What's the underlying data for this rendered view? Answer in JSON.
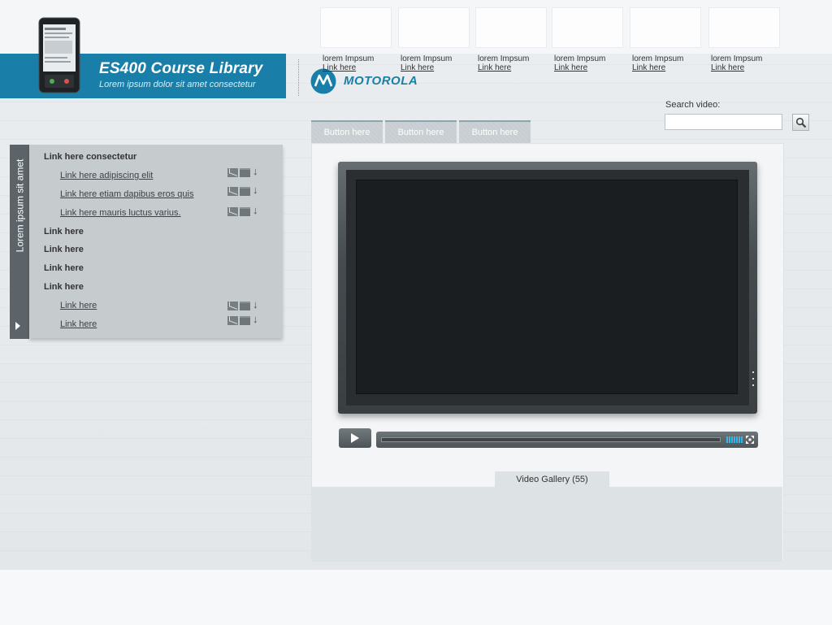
{
  "header": {
    "title": "ES400 Course Library",
    "subtitle": "Lorem ipsum dolor sit amet consectetur",
    "brand": "MOTOROLA"
  },
  "search": {
    "label": "Search video:",
    "value": ""
  },
  "tabs": [
    {
      "label": "Button here"
    },
    {
      "label": "Button here"
    },
    {
      "label": "Button here"
    }
  ],
  "sidebar": {
    "vertical_label": "Lorem ipsum sit amet",
    "items": [
      {
        "label": "Link here consectetur",
        "type": "heading"
      },
      {
        "label": "Link here adipiscing elit",
        "type": "link"
      },
      {
        "label": "Link here etiam dapibus eros quis",
        "type": "link"
      },
      {
        "label": "Link here  mauris luctus varius.",
        "type": "link"
      },
      {
        "label": "Link here",
        "type": "heading"
      },
      {
        "label": "Link here",
        "type": "heading"
      },
      {
        "label": "Link here",
        "type": "heading"
      },
      {
        "label": "Link here",
        "type": "heading"
      },
      {
        "label": "Link here",
        "type": "link"
      },
      {
        "label": "Link here",
        "type": "link"
      }
    ]
  },
  "gallery": {
    "tab_label": "Video Gallery (55)",
    "items": [
      {
        "caption": "lorem Impsum",
        "link": "Link here"
      },
      {
        "caption": "lorem Impsum",
        "link": "Link here"
      },
      {
        "caption": "lorem Impsum",
        "link": "Link here"
      },
      {
        "caption": "lorem Impsum",
        "link": "Link here"
      },
      {
        "caption": "lorem Impsum",
        "link": "Link here"
      },
      {
        "caption": "lorem Impsum",
        "link": "Link here"
      }
    ]
  },
  "colors": {
    "accent": "#1a7fa8",
    "volume": "#37b7e6"
  }
}
